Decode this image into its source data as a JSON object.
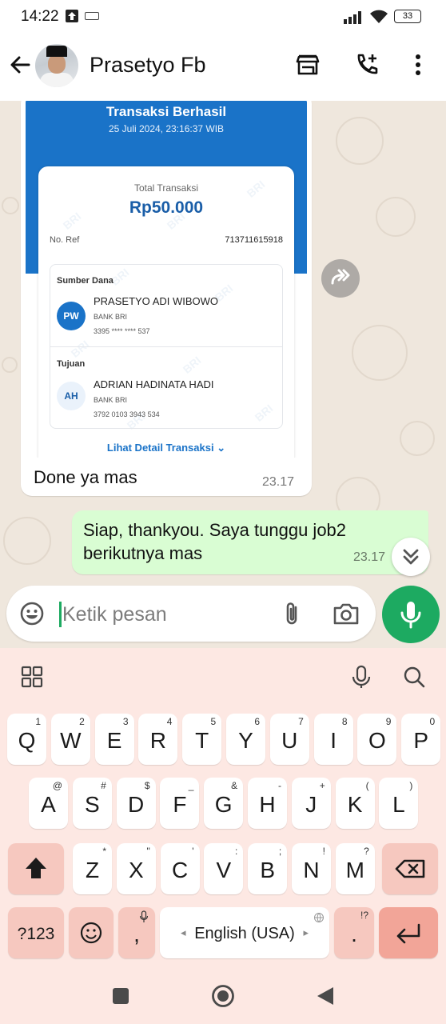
{
  "status_bar": {
    "time": "14:22",
    "battery": "33",
    "icons": [
      "upload-icon",
      "keyboard-icon",
      "signal-icon",
      "wifi-icon",
      "battery-icon"
    ]
  },
  "header": {
    "contact_name": "Prasetyo Fb",
    "icons": [
      "back-arrow-icon",
      "store-icon",
      "add-call-icon",
      "more-vert-icon"
    ]
  },
  "receipt": {
    "title": "Transaksi Berhasil",
    "datetime": "25 Juli 2024, 23:16:37 WIB",
    "total_label": "Total Transaksi",
    "total_amount": "Rp50.000",
    "ref_label": "No. Ref",
    "ref_number": "713711615918",
    "source": {
      "label": "Sumber Dana",
      "initials": "PW",
      "name": "PRASETYO ADI WIBOWO",
      "bank": "BANK BRI",
      "account": "3395 **** **** 537"
    },
    "destination": {
      "label": "Tujuan",
      "initials": "AH",
      "name": "ADRIAN HADINATA HADI",
      "bank": "BANK BRI",
      "account": "3792 0103 3943 534"
    },
    "detail_link": "Lihat Detail Transaksi",
    "watermark": "BRI"
  },
  "messages": [
    {
      "direction": "in",
      "text": "Done ya mas",
      "time": "23.17"
    },
    {
      "direction": "out",
      "text": "Siap, thankyou. Saya tunggu job2 berikutnya mas",
      "time": "23.17"
    }
  ],
  "composer": {
    "placeholder": "Ketik pesan",
    "icons": [
      "emoji-icon",
      "paperclip-icon",
      "camera-icon",
      "mic-icon"
    ]
  },
  "keyboard": {
    "row1": [
      {
        "key": "Q",
        "hint": "1"
      },
      {
        "key": "W",
        "hint": "2"
      },
      {
        "key": "E",
        "hint": "3"
      },
      {
        "key": "R",
        "hint": "4"
      },
      {
        "key": "T",
        "hint": "5"
      },
      {
        "key": "Y",
        "hint": "6"
      },
      {
        "key": "U",
        "hint": "7"
      },
      {
        "key": "I",
        "hint": "8"
      },
      {
        "key": "O",
        "hint": "9"
      },
      {
        "key": "P",
        "hint": "0"
      }
    ],
    "row2": [
      {
        "key": "A",
        "hint": "@"
      },
      {
        "key": "S",
        "hint": "#"
      },
      {
        "key": "D",
        "hint": "$"
      },
      {
        "key": "F",
        "hint": "_"
      },
      {
        "key": "G",
        "hint": "&"
      },
      {
        "key": "H",
        "hint": "-"
      },
      {
        "key": "J",
        "hint": "+"
      },
      {
        "key": "K",
        "hint": "("
      },
      {
        "key": "L",
        "hint": ")"
      }
    ],
    "row3": [
      {
        "key": "Z",
        "hint": "*"
      },
      {
        "key": "X",
        "hint": "\""
      },
      {
        "key": "C",
        "hint": "'"
      },
      {
        "key": "V",
        "hint": ":"
      },
      {
        "key": "B",
        "hint": ";"
      },
      {
        "key": "N",
        "hint": "!"
      },
      {
        "key": "M",
        "hint": "?"
      }
    ],
    "symbols_key": "?123",
    "comma_key": ",",
    "space_label": "English (USA)",
    "period_key": ".",
    "period_hint": "!?"
  }
}
